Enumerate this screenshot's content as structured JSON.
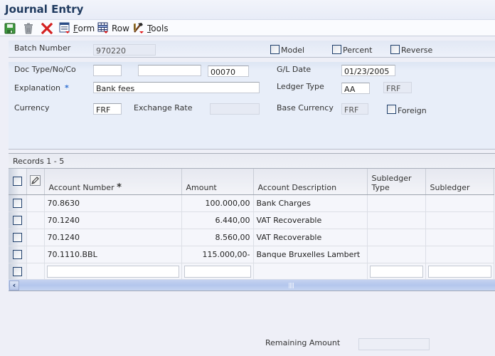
{
  "window": {
    "title": "Journal Entry"
  },
  "toolbar": {
    "save": "save-icon",
    "delete": "trash-icon",
    "close": "close-icon",
    "form_label_pre": "",
    "form_label_u": "F",
    "form_label_rest": "orm",
    "row_label": "Row",
    "tools_label_u": "T",
    "tools_label_rest": "ools"
  },
  "batch": {
    "label": "Batch Number",
    "value": "970220",
    "model_label": "Model",
    "percent_label": "Percent",
    "reverse_label": "Reverse"
  },
  "header": {
    "doc_label": "Doc Type/No/Co",
    "doc_type": "",
    "doc_no": "",
    "doc_co": "00070",
    "gl_date_label": "G/L Date",
    "gl_date": "01/23/2005",
    "explanation_label": "Explanation",
    "required_mark": "*",
    "explanation": "Bank fees",
    "ledger_type_label": "Ledger Type",
    "ledger_type": "AA",
    "ledger_currency": "FRF",
    "currency_label": "Currency",
    "currency": "FRF",
    "exchange_rate_label": "Exchange Rate",
    "exchange_rate": "",
    "base_currency_label": "Base Currency",
    "base_currency": "FRF",
    "foreign_label": "Foreign"
  },
  "grid": {
    "records_label": "Records 1 - 5",
    "columns": {
      "account_number": "Account Number",
      "required_mark": "*",
      "amount": "Amount",
      "account_description": "Account Description",
      "subledger_type": "Subledger Type",
      "subledger": "Subledger"
    },
    "rows": [
      {
        "account_number": "70.8630",
        "amount": "100.000,00",
        "description": "Bank Charges",
        "subledger_type": "",
        "subledger": ""
      },
      {
        "account_number": "70.1240",
        "amount": "6.440,00",
        "description": "VAT Recoverable",
        "subledger_type": "",
        "subledger": ""
      },
      {
        "account_number": "70.1240",
        "amount": "8.560,00",
        "description": "VAT Recoverable",
        "subledger_type": "",
        "subledger": ""
      },
      {
        "account_number": "70.1110.BBL",
        "amount": "115.000,00-",
        "description": "Banque Bruxelles Lambert",
        "subledger_type": "",
        "subledger": ""
      }
    ]
  },
  "footer": {
    "remaining_amount_label": "Remaining Amount",
    "remaining_amount": ""
  }
}
